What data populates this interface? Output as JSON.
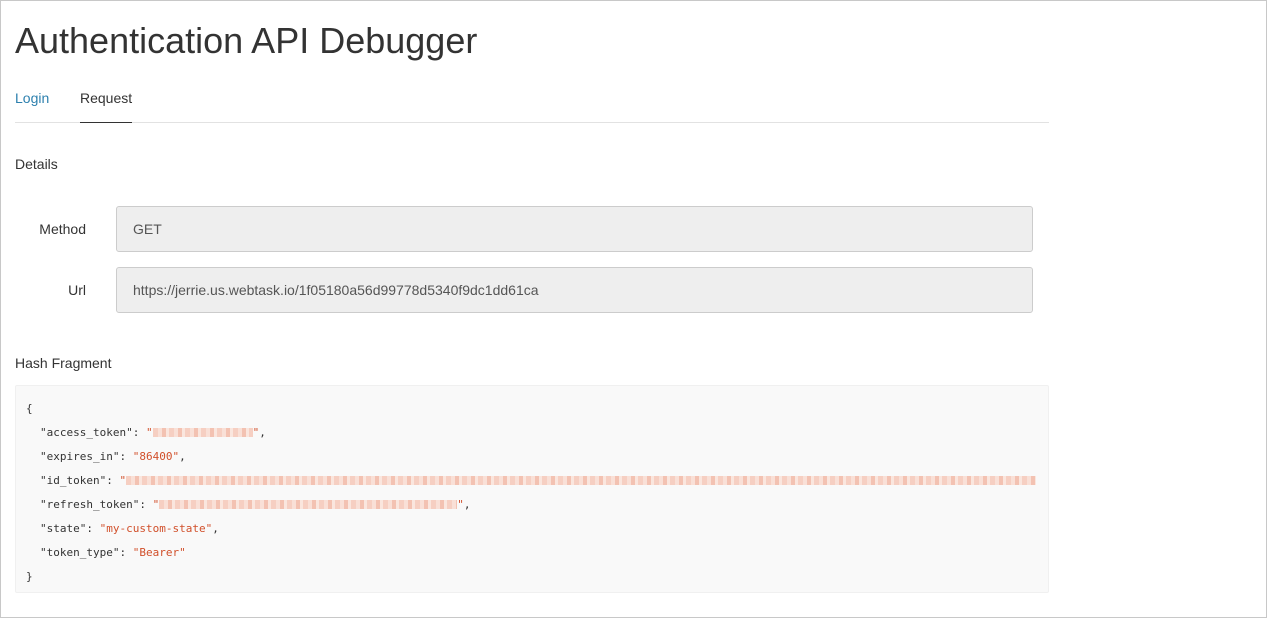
{
  "page": {
    "title": "Authentication API Debugger"
  },
  "tabs": [
    {
      "label": "Login",
      "active": false
    },
    {
      "label": "Request",
      "active": true
    }
  ],
  "details": {
    "heading": "Details",
    "method": {
      "label": "Method",
      "value": "GET"
    },
    "url": {
      "label": "Url",
      "value": "https://jerrie.us.webtask.io/1f05180a56d99778d5340f9dc1dd61ca"
    }
  },
  "hash_fragment": {
    "heading": "Hash Fragment",
    "open_brace": "{",
    "close_brace": "}",
    "entries": [
      {
        "key": "\"access_token\"",
        "value": "[redacted]",
        "redacted": true
      },
      {
        "key": "\"expires_in\"",
        "value": "\"86400\"",
        "redacted": false
      },
      {
        "key": "\"id_token\"",
        "value": "[redacted]",
        "redacted": true
      },
      {
        "key": "\"refresh_token\"",
        "value": "[redacted]",
        "redacted": true
      },
      {
        "key": "\"state\"",
        "value": "\"my-custom-state\"",
        "redacted": false
      },
      {
        "key": "\"token_type\"",
        "value": "\"Bearer\"",
        "redacted": false
      }
    ]
  },
  "colors": {
    "link": "#2d80ae",
    "string_value": "#d14f2a",
    "input_bg": "#eeeeee"
  }
}
